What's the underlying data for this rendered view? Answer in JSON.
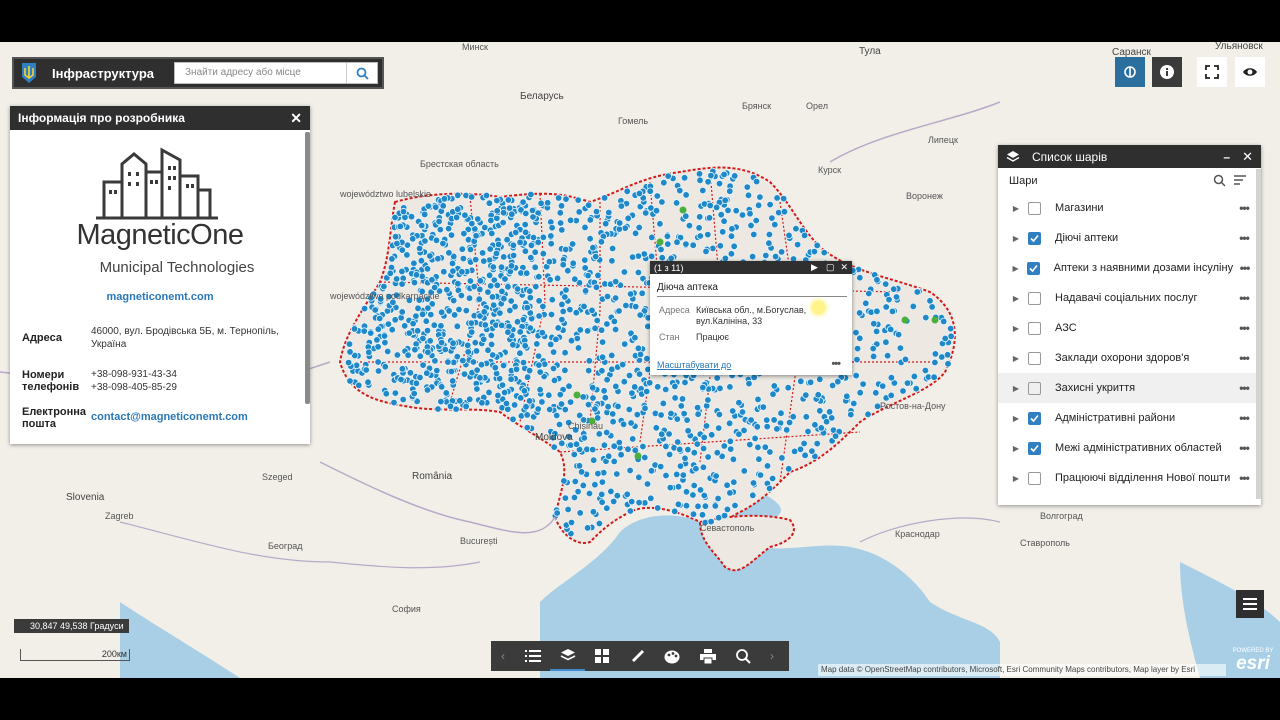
{
  "app": {
    "title": "Інфраструктура",
    "search_placeholder": "Знайти адресу або місце"
  },
  "developer_panel": {
    "title": "Інформація про розробника",
    "brand_name": "MagneticOne",
    "brand_tagline": "Municipal Technologies",
    "website": "magneticonemt.com",
    "address_label": "Адреса",
    "address_value": "46000, вул. Бродівська 5Б, м. Тернопіль, Україна",
    "phones_label_1": "Номери",
    "phones_label_2": "телефонів",
    "phone_1": "+38-098-931-43-34",
    "phone_2": "+38-098-405-85-29",
    "email_label_1": "Електронна",
    "email_label_2": "пошта",
    "email_value": "contact@magneticonemt.com"
  },
  "layer_list": {
    "title": "Список шарів",
    "subheading": "Шари",
    "items": [
      {
        "label": "Магазини",
        "checked": false
      },
      {
        "label": "Діючі аптеки",
        "checked": true
      },
      {
        "label": "Аптеки з наявними дозами інсуліну",
        "checked": true
      },
      {
        "label": "Надавачі соціальних послуг",
        "checked": false
      },
      {
        "label": "АЗС",
        "checked": false
      },
      {
        "label": "Заклади охорони здоров'я",
        "checked": false
      },
      {
        "label": "Захисні укриття",
        "checked": false
      },
      {
        "label": "Адміністративні райони",
        "checked": true
      },
      {
        "label": "Межі адміністративних областей",
        "checked": true
      },
      {
        "label": "Працюючі відділення Нової пошти",
        "checked": false
      }
    ]
  },
  "popup": {
    "counter": "(1 з 11)",
    "title": "Діюча аптека",
    "address_key": "Адреса",
    "address_value": "Київська обл., м.Богуслав, вул.Калініна, 33",
    "status_key": "Стан",
    "status_value": "Працює",
    "zoom_link": "Масштабувати до"
  },
  "status": {
    "coordinates": "30,847 49,538 Градуси",
    "scale": "200км",
    "attribution": "Map data © OpenStreetMap contributors, Microsoft, Esri Community Maps contributors, Map layer by Esri",
    "esri_powered": "POWERED BY",
    "esri": "esri"
  },
  "map_labels": {
    "tula": "Тула",
    "saransk": "Саранск",
    "ulyanovsk": "Ульяновск",
    "belarus": "Беларусь",
    "bryansk": "Брянск",
    "orel": "Орел",
    "voronezh": "Воронеж",
    "lipetsk": "Липецк",
    "kursk": "Курск",
    "moldova": "Moldova",
    "romania": "România",
    "slovenia": "Slovenia",
    "belgrade": "Београд",
    "sofia": "София",
    "krasnodar": "Краснодар",
    "stavropol": "Ставрополь",
    "sevastopol": "Севастополь",
    "szeged": "Szeged",
    "zagreb": "Zagreb",
    "bucuresti": "București",
    "chisinau": "Chișinău",
    "gomel": "Гомель",
    "minsk": "Минск",
    "brest": "Брестская область",
    "rostov": "Ростов-на-Дону",
    "volgograd": "Волгоград",
    "lublin": "województwo lubelskie",
    "podkarp": "województwo podkarpackie"
  },
  "colors": {
    "panel_header": "#2f2f2f",
    "accent": "#2f7fc1",
    "point": "#1e88c8",
    "boundary": "#d21a1a"
  }
}
